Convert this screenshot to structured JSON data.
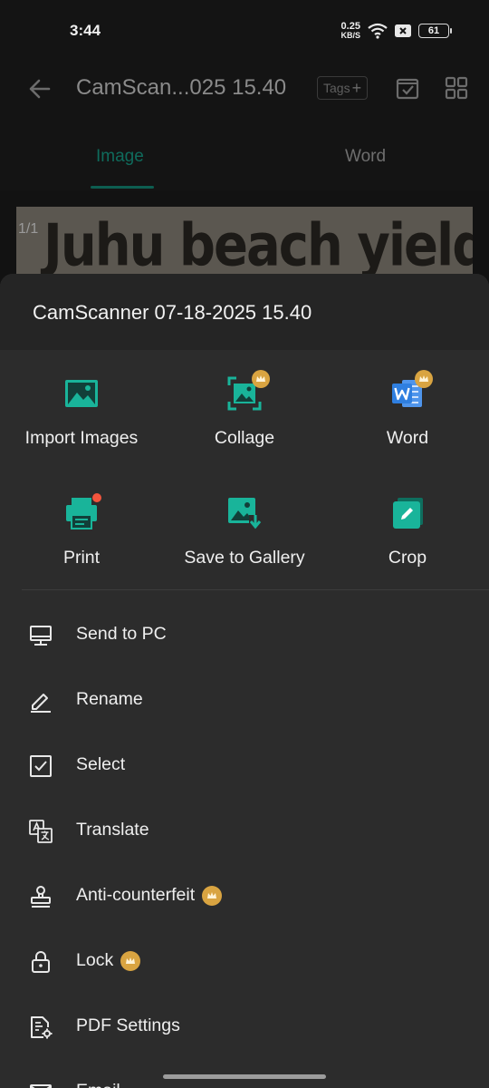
{
  "status": {
    "time": "3:44",
    "speed_value": "0.25",
    "speed_unit": "KB/S",
    "battery": "61"
  },
  "app_bar": {
    "title": "CamScan...025 15.40",
    "tags_label": "Tags",
    "tags_plus": "+"
  },
  "tabs": [
    {
      "label": "Image"
    },
    {
      "label": "Word"
    }
  ],
  "preview": {
    "page_indicator": "1/1",
    "scan_headline": "Juhu beach yields"
  },
  "sheet": {
    "title": "CamScanner 07-18-2025 15.40",
    "grid_actions": [
      {
        "label": "Import Images",
        "icon": "image-icon"
      },
      {
        "label": "Collage",
        "icon": "collage-icon",
        "premium": true
      },
      {
        "label": "Word",
        "icon": "word-icon",
        "premium": true
      },
      {
        "label": "Print",
        "icon": "printer-icon",
        "notification_dot": true
      },
      {
        "label": "Save to Gallery",
        "icon": "save-to-gallery-icon"
      },
      {
        "label": "Crop",
        "icon": "crop-icon"
      }
    ],
    "list_actions": [
      {
        "label": "Send to PC",
        "icon": "computer-icon"
      },
      {
        "label": "Rename",
        "icon": "pencil-icon"
      },
      {
        "label": "Select",
        "icon": "checkbox-icon"
      },
      {
        "label": "Translate",
        "icon": "translate-icon"
      },
      {
        "label": "Anti-counterfeit",
        "icon": "stamp-icon",
        "premium": true
      },
      {
        "label": "Lock",
        "icon": "lock-icon",
        "premium": true
      },
      {
        "label": "PDF Settings",
        "icon": "pdf-settings-icon"
      },
      {
        "label": "Email",
        "icon": "email-icon"
      }
    ]
  },
  "colors": {
    "accent": "#19b49a",
    "premium": "#d9a441",
    "sheet_bg": "#2c2c2c",
    "word_blue": "#2f7fe0"
  }
}
